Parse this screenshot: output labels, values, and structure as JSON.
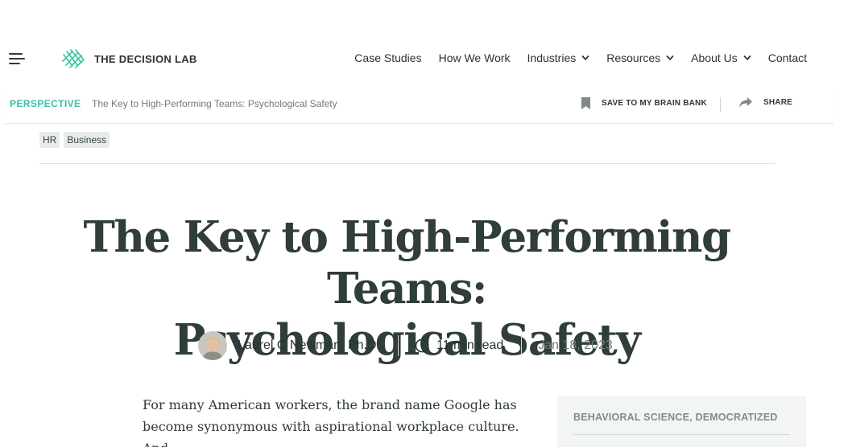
{
  "nav": {
    "logo_text": "THE DECISION LAB",
    "links": [
      {
        "label": "Case Studies",
        "has_dropdown": false
      },
      {
        "label": "How We Work",
        "has_dropdown": false
      },
      {
        "label": "Industries",
        "has_dropdown": true
      },
      {
        "label": "Resources",
        "has_dropdown": true
      },
      {
        "label": "About Us",
        "has_dropdown": true
      },
      {
        "label": "Contact",
        "has_dropdown": false
      }
    ]
  },
  "perspective_bar": {
    "label": "PERSPECTIVE",
    "title": "The Key to High-Performing Teams: Psychological Safety",
    "save_label": "SAVE TO MY BRAIN BANK",
    "share_label": "SHARE"
  },
  "tags": [
    "HR",
    "Business"
  ],
  "article": {
    "headline_line1": "The Key to High-Performing Teams:",
    "headline_line2": "Psychological Safety",
    "author": "Laurel C Newman, Ph.D.",
    "read_time": "11 min read",
    "date": "Jan 18, 2023",
    "body_line1": "For many American workers, the brand name Google has",
    "body_line2": "become synonymous with aspirational workplace culture. And"
  },
  "sidebar": {
    "heading": "BEHAVIORAL SCIENCE, DEMOCRATIZED"
  },
  "colors": {
    "accent": "#37c2a6",
    "text_dark": "#2f3d3b",
    "text_muted": "#6f7a79",
    "tag_bg": "#e8ebeb",
    "sidebar_bg": "#f3f5f5"
  },
  "icons": {
    "menu": "hamburger-icon",
    "logo": "decision-lab-logo-icon",
    "dropdown": "chevron-down-icon",
    "save": "bookmark-icon",
    "share": "share-arrow-icon",
    "read_time": "clock-icon"
  }
}
